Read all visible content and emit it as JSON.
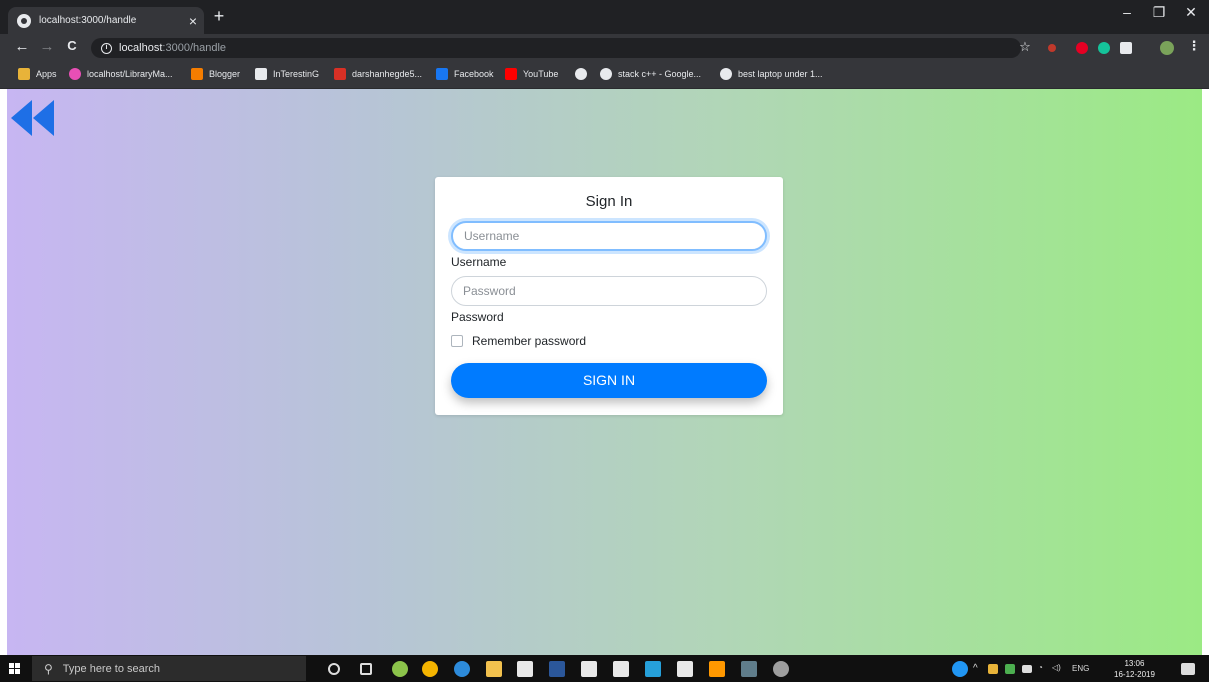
{
  "browser": {
    "tab_title": "localhost:3000/handle",
    "tab_close": "×",
    "new_tab": "+",
    "window": {
      "minimize": "–",
      "restore": "❐",
      "close": "✕"
    },
    "nav": {
      "back": "←",
      "forward": "→",
      "reload": "C"
    },
    "address": {
      "host": "localhost",
      "path": ":3000/handle"
    },
    "bookmarks": [
      {
        "label": "Apps",
        "color": "#e8b339"
      },
      {
        "label": "localhost/LibraryMa...",
        "color": "#e84fb5"
      },
      {
        "label": "Blogger",
        "color": "#f57d00"
      },
      {
        "label": "InTerestinG",
        "color": "#e8eaed"
      },
      {
        "label": "darshanhegde5...",
        "color": "#d93025"
      },
      {
        "label": "Facebook",
        "color": "#1877f2"
      },
      {
        "label": "YouTube",
        "color": "#ff0000"
      },
      {
        "label": "",
        "color": "#e8eaed"
      },
      {
        "label": "stack c++ - Google...",
        "color": "#e8eaed"
      },
      {
        "label": "best laptop under 1...",
        "color": "#e8eaed"
      }
    ]
  },
  "page": {
    "back_icon": "double-chevron-left",
    "accent": "#007bff",
    "gradient": [
      "#c7b6f2",
      "#b1d6b7",
      "#9bea84"
    ]
  },
  "form": {
    "title": "Sign In",
    "username_placeholder": "Username",
    "username_label": "Username",
    "password_placeholder": "Password",
    "password_label": "Password",
    "remember_label": "Remember password",
    "submit_label": "SIGN IN"
  },
  "taskbar": {
    "search_placeholder": "Type here to search",
    "lang": "ENG",
    "time": "13:06",
    "date": "16-12-2019"
  }
}
